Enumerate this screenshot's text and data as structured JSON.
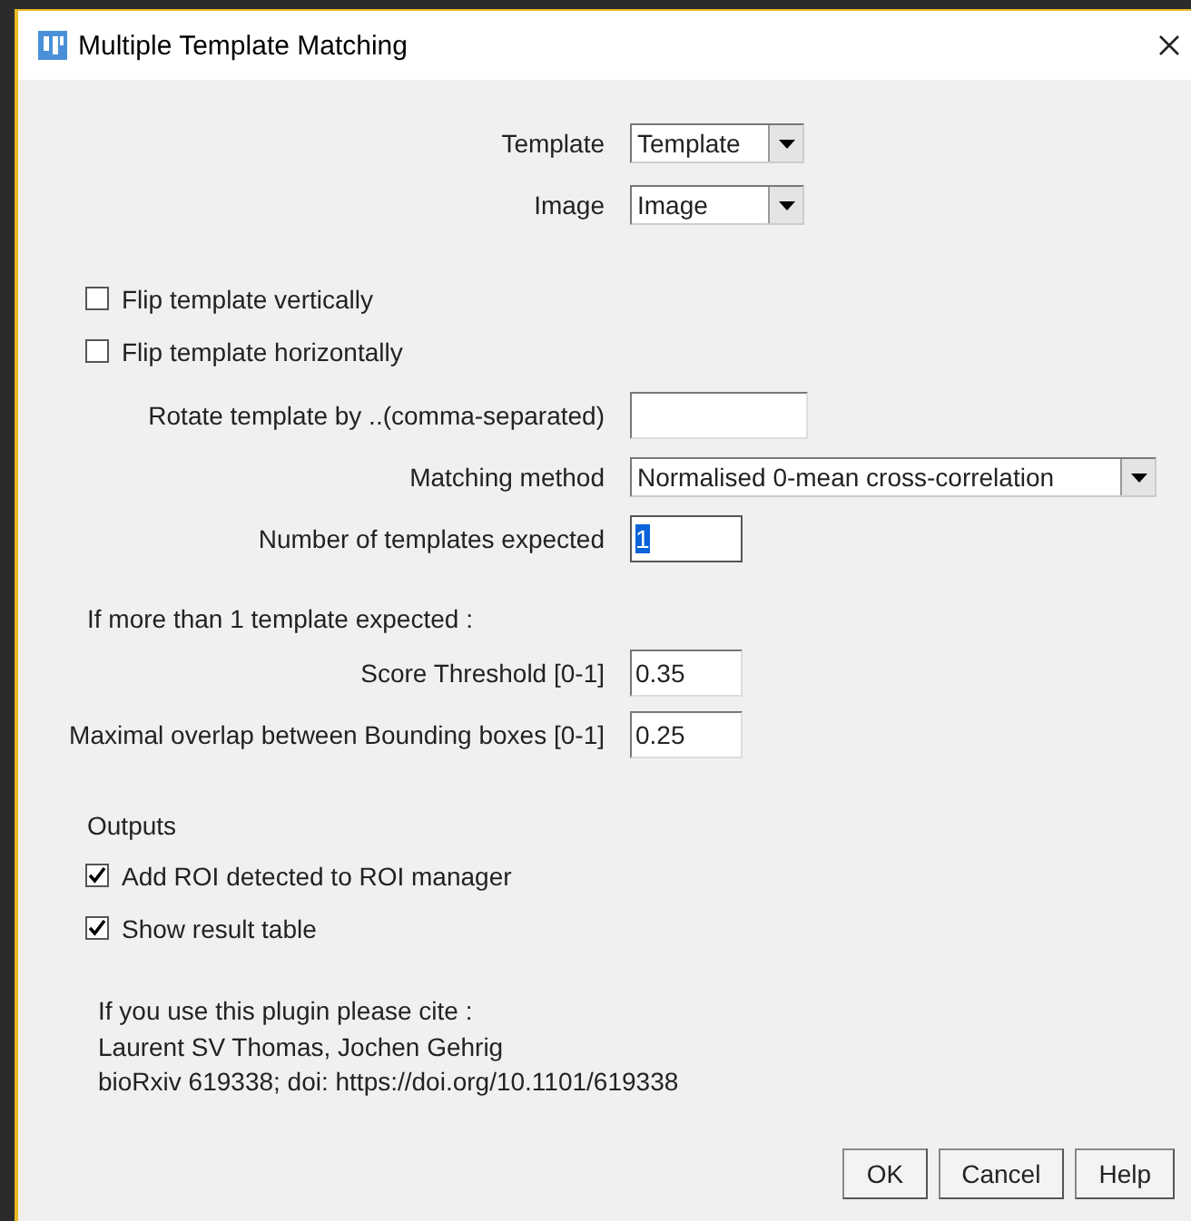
{
  "window": {
    "title": "Multiple Template Matching"
  },
  "sections": [
    {
      "rows": [
        {
          "kind": "choice",
          "label": "Template",
          "value": "Template"
        },
        {
          "kind": "choice",
          "label": "Image",
          "value": "Image"
        }
      ]
    },
    {
      "rows": [
        {
          "kind": "checkbox",
          "label": "Flip template vertically",
          "checked": false
        },
        {
          "kind": "checkbox",
          "label": "Flip template horizontally",
          "checked": false
        }
      ]
    },
    {
      "rows": [
        {
          "kind": "text",
          "label": "Rotate template by ..(comma-separated)",
          "value_highlighted": false
        },
        {
          "kind": "choice",
          "label": "Matching method",
          "value": "Normalised 0-mean cross-correlation"
        },
        {
          "kind": "text",
          "label": "Number of templates expected",
          "value": "1",
          "value_highlighted": true
        }
      ]
    },
    {
      "rows": [
        {
          "kind": "note",
          "label": "If more than 1 template expected :"
        },
        {
          "kind": "text",
          "label": "Score Threshold [0-1]",
          "value": "0.35",
          "value_highlighted": false
        },
        {
          "kind": "text",
          "label": "Maximal overlap between Bounding boxes [0-1]",
          "value": "0.25",
          "value_highlighted": false
        }
      ]
    },
    {
      "rows": [
        {
          "kind": "note",
          "label": "Outputs"
        },
        {
          "kind": "checkbox",
          "label": "Add ROI detected to ROI manager",
          "checked": true
        },
        {
          "kind": "checkbox",
          "label": "Show result table",
          "checked": true
        }
      ]
    }
  ],
  "citation": [
    "If you use this plugin please cite :",
    "Laurent SV Thomas, Jochen Gehrig",
    "bioRxiv 619338; doi: https://doi.org/10.1101/619338"
  ],
  "buttons": [
    "OK",
    "Cancel",
    "Help"
  ]
}
